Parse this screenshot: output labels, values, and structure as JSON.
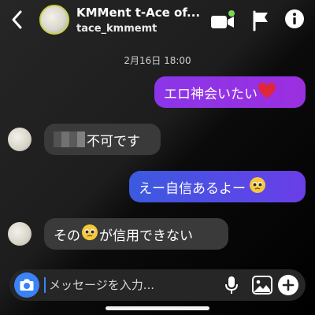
{
  "header": {
    "title": "KMMent t-Ace of...",
    "subtitle": "tace_kmmemt",
    "icons": [
      "back-icon",
      "video-call-icon",
      "flag-icon",
      "info-icon"
    ],
    "video_dot_color": "#7bd94c"
  },
  "thread": {
    "timestamp": "2月16日 18:00",
    "messages": [
      {
        "direction": "outgoing",
        "text": "エロ神会いたい",
        "emoji": "❤️"
      },
      {
        "direction": "incoming",
        "redacted_prefix": true,
        "text": "不可です"
      },
      {
        "direction": "outgoing",
        "text": "えー自信あるよー",
        "emoji": "🥺"
      },
      {
        "direction": "incoming",
        "text_before": "その",
        "emoji": "🥺",
        "text_after": "が信用できない"
      }
    ]
  },
  "composer": {
    "placeholder": "メッセージを入力...",
    "icons": [
      "camera-icon",
      "microphone-icon",
      "gallery-icon",
      "plus-icon"
    ],
    "accent": "#3b82f6"
  },
  "colors": {
    "outgoing_purple": "#9b2fe0",
    "outgoing_blue": "#3b5ae0",
    "incoming_bubble": "#3a3a3a"
  }
}
